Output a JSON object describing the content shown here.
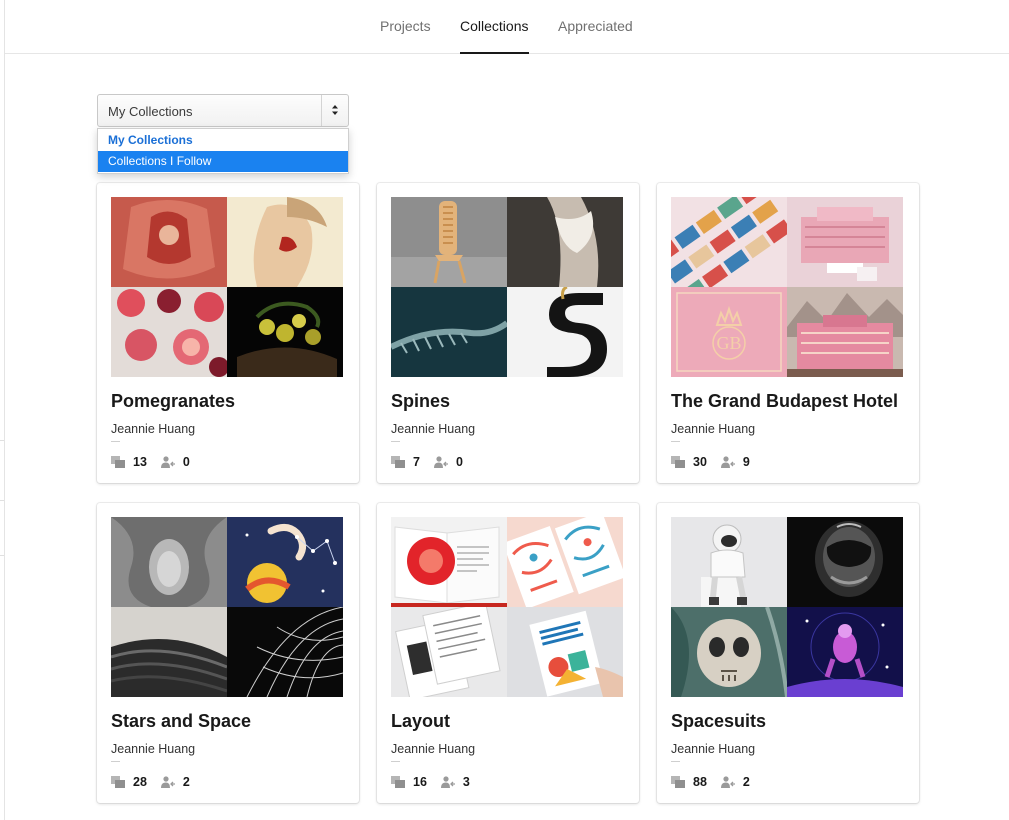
{
  "tabs": [
    "Projects",
    "Collections",
    "Appreciated"
  ],
  "active_tab": "Collections",
  "collections_select": {
    "value": "My Collections",
    "options": [
      "My Collections",
      "Collections I Follow"
    ],
    "highlighted_option": "Collections I Follow"
  },
  "collections": [
    {
      "title": "Pomegranates",
      "owner": "Jeannie Huang",
      "projects": "13",
      "followers": "0"
    },
    {
      "title": "Spines",
      "owner": "Jeannie Huang",
      "projects": "7",
      "followers": "0"
    },
    {
      "title": "The Grand Budapest Hotel",
      "owner": "Jeannie Huang",
      "projects": "30",
      "followers": "9"
    },
    {
      "title": "Stars and Space",
      "owner": "Jeannie Huang",
      "projects": "28",
      "followers": "2"
    },
    {
      "title": "Layout",
      "owner": "Jeannie Huang",
      "projects": "16",
      "followers": "3"
    },
    {
      "title": "Spacesuits",
      "owner": "Jeannie Huang",
      "projects": "88",
      "followers": "2"
    }
  ],
  "icons": {
    "projects": "stacked-squares-icon",
    "followers": "person-follow-icon"
  },
  "colors": {
    "accent": "#1a82f0",
    "text": "#191919",
    "muted": "#707070"
  }
}
